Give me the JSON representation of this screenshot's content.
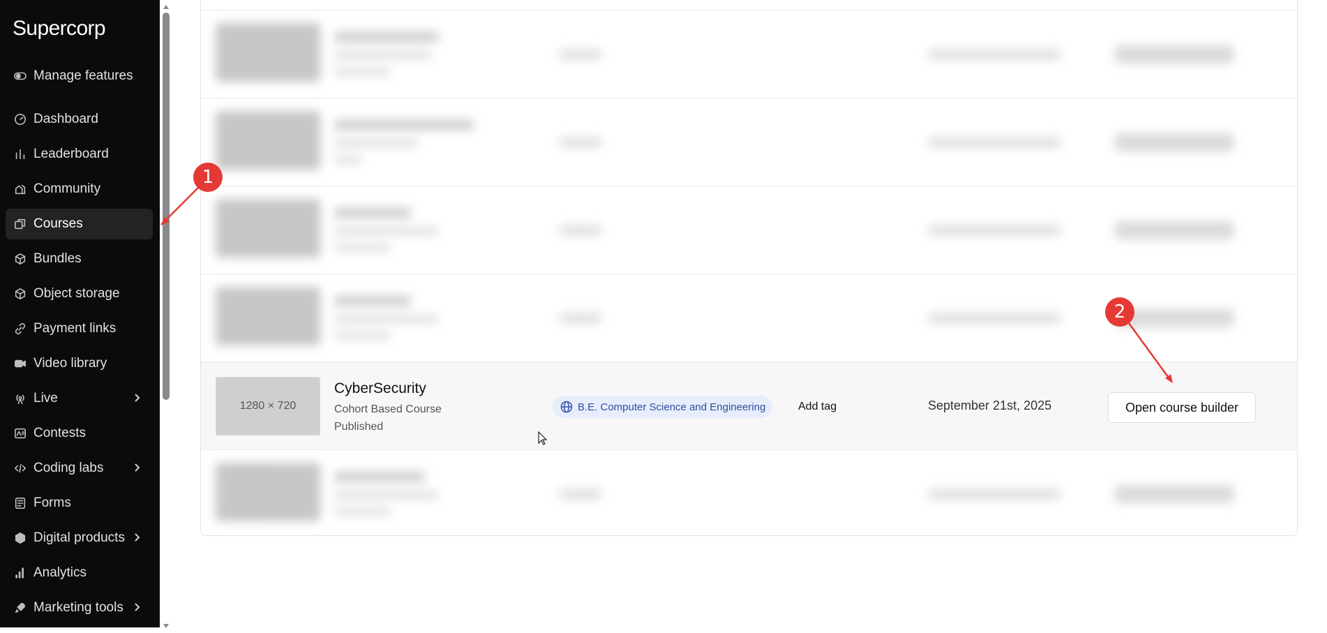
{
  "sidebar": {
    "brand": "Supercorp",
    "items": [
      {
        "label": "Manage features",
        "icon": "toggle-icon"
      },
      {
        "label": "Dashboard",
        "icon": "gauge-icon"
      },
      {
        "label": "Leaderboard",
        "icon": "bar-chart-icon"
      },
      {
        "label": "Community",
        "icon": "community-icon"
      },
      {
        "label": "Courses",
        "icon": "copy-icon",
        "active": true
      },
      {
        "label": "Bundles",
        "icon": "package-icon"
      },
      {
        "label": "Object storage",
        "icon": "box-icon"
      },
      {
        "label": "Payment links",
        "icon": "link-icon"
      },
      {
        "label": "Video library",
        "icon": "video-icon"
      },
      {
        "label": "Live",
        "icon": "broadcast-icon",
        "expandable": true
      },
      {
        "label": "Contests",
        "icon": "contest-icon"
      },
      {
        "label": "Coding labs",
        "icon": "code-icon",
        "expandable": true
      },
      {
        "label": "Forms",
        "icon": "form-icon"
      },
      {
        "label": "Digital products",
        "icon": "digital-product-icon",
        "expandable": true
      },
      {
        "label": "Analytics",
        "icon": "analytics-icon"
      },
      {
        "label": "Marketing tools",
        "icon": "rocket-icon",
        "expandable": true
      }
    ]
  },
  "course_row": {
    "thumbnail": "1280 × 720",
    "title": "CyberSecurity",
    "type": "Cohort Based Course",
    "status": "Published",
    "tag": "B.E. Computer Science and Engineering",
    "add_tag": "Add tag",
    "date": "September 21st, 2025",
    "action": "Open course builder"
  },
  "annotations": {
    "first": "1",
    "second": "2"
  },
  "colors": {
    "sidebar_bg": "#0b0b0b",
    "tag_bg": "#e7edfb",
    "tag_text": "#2f4f9e",
    "annotation": "#e53935"
  }
}
